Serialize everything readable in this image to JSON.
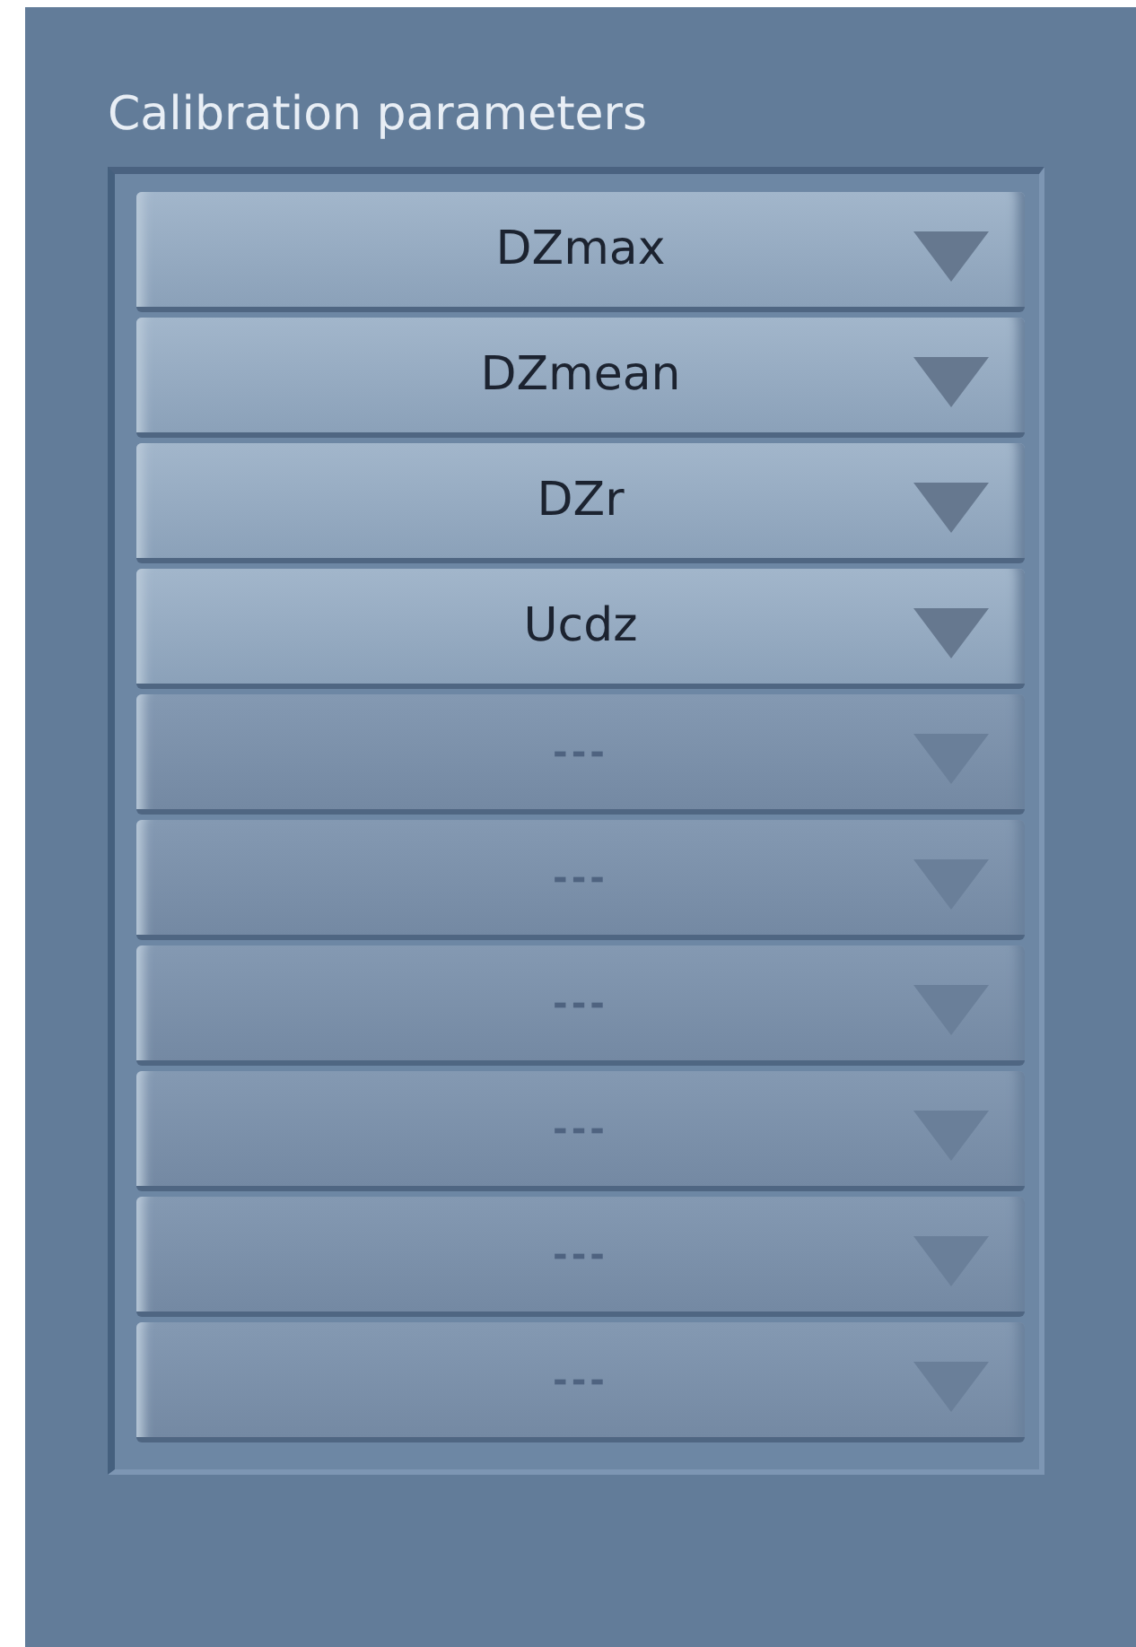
{
  "panel": {
    "title": "Calibration parameters"
  },
  "dropdowns": [
    {
      "label": "DZmax",
      "disabled": false
    },
    {
      "label": "DZmean",
      "disabled": false
    },
    {
      "label": "DZr",
      "disabled": false
    },
    {
      "label": "Ucdz",
      "disabled": false
    },
    {
      "label": "---",
      "disabled": true
    },
    {
      "label": "---",
      "disabled": true
    },
    {
      "label": "---",
      "disabled": true
    },
    {
      "label": "---",
      "disabled": true
    },
    {
      "label": "---",
      "disabled": true
    },
    {
      "label": "---",
      "disabled": true
    }
  ]
}
